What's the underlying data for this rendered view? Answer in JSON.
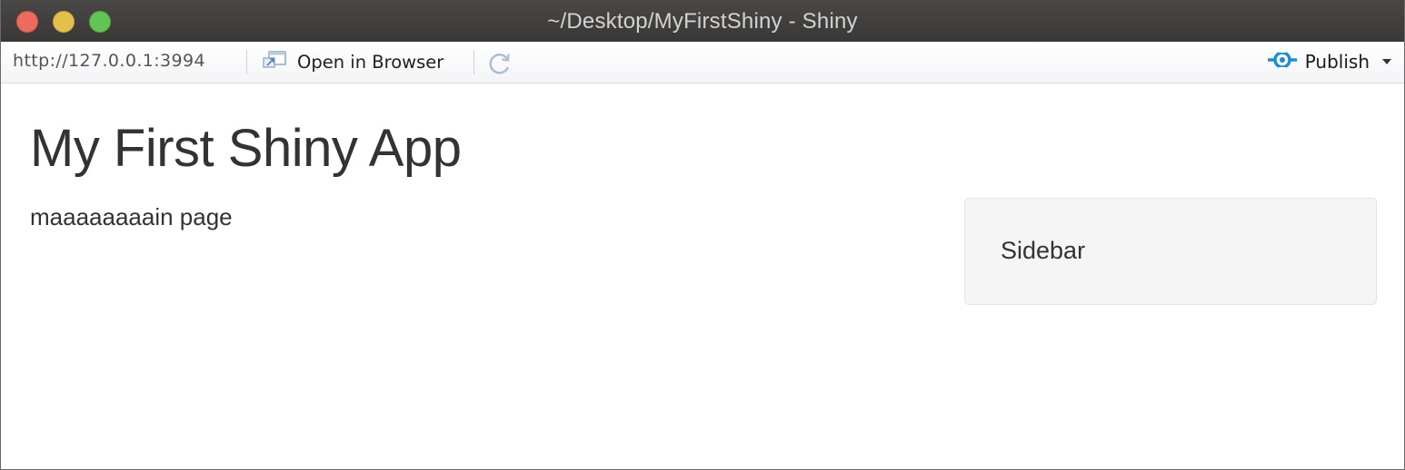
{
  "window": {
    "title": "~/Desktop/MyFirstShiny - Shiny"
  },
  "toolbar": {
    "url": "http://127.0.0.1:3994",
    "open_in_browser_label": "Open in Browser",
    "publish_label": "Publish",
    "icons": {
      "open_in_browser": "open-in-browser-icon",
      "refresh": "refresh-icon",
      "publish": "publish-icon",
      "publish_menu": "chevron-down-icon"
    },
    "accent_color": "#1a8fd6"
  },
  "app": {
    "title": "My First Shiny App",
    "main_text": "maaaaaaaain page",
    "sidebar_text": "Sidebar"
  }
}
